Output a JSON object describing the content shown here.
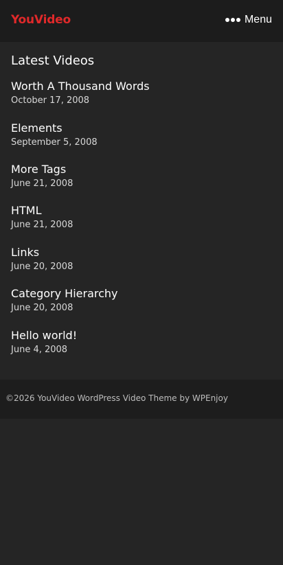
{
  "header": {
    "logo_text": "YouVideo",
    "logo_color": "#e0292a",
    "menu_label": "Menu",
    "menu_icon": "three-dots-icon"
  },
  "main": {
    "section_title": "Latest Videos",
    "videos": [
      {
        "title": "Worth A Thousand Words",
        "date": "October 17, 2008"
      },
      {
        "title": "Elements",
        "date": "September 5, 2008"
      },
      {
        "title": "More Tags",
        "date": "June 21, 2008"
      },
      {
        "title": "HTML",
        "date": "June 21, 2008"
      },
      {
        "title": "Links",
        "date": "June 20, 2008"
      },
      {
        "title": "Category Hierarchy",
        "date": "June 20, 2008"
      },
      {
        "title": "Hello world!",
        "date": "June 4, 2008"
      }
    ]
  },
  "footer": {
    "text": "©2026 YouVideo WordPress Video Theme by WPEnjoy"
  },
  "colors": {
    "background": "#252525",
    "header_background": "#1c1c1c",
    "footer_background": "#1d1d1d",
    "text_primary": "#ffffff",
    "text_secondary": "#d8d8d8"
  }
}
